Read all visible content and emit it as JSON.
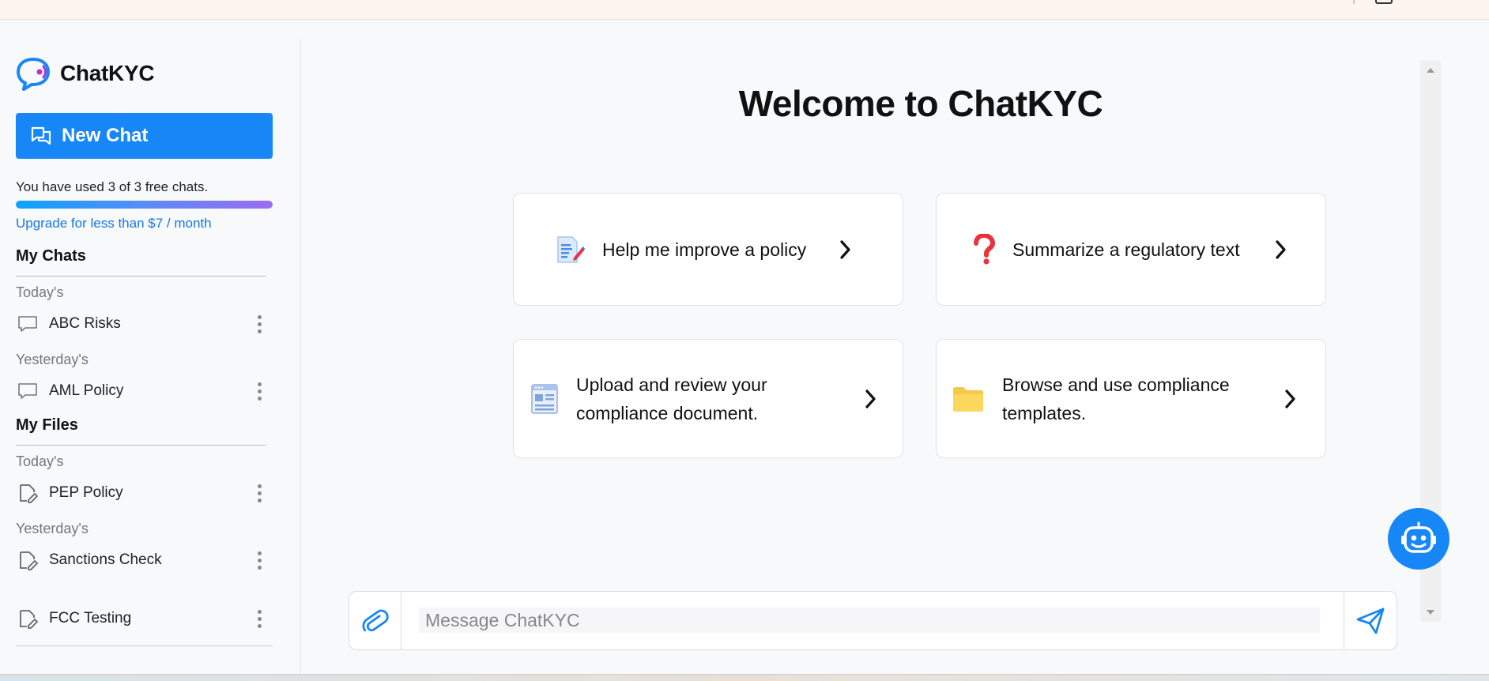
{
  "app": {
    "name": "ChatKYC"
  },
  "sidebar": {
    "new_chat_label": "New Chat",
    "usage_text": "You have used 3 of 3 free chats.",
    "usage_fraction": 1.0,
    "upgrade_label": "Upgrade for less than $7 / month",
    "chats_title": "My Chats",
    "chats": {
      "today_label": "Today's",
      "today": [
        {
          "label": "ABC Risks"
        }
      ],
      "yesterday_label": "Yesterday's",
      "yesterday": [
        {
          "label": "AML Policy"
        }
      ]
    },
    "files_title": "My Files",
    "files": {
      "today_label": "Today's",
      "today": [
        {
          "label": "PEP Policy"
        }
      ],
      "yesterday_label": "Yesterday's",
      "yesterday": [
        {
          "label": "Sanctions Check"
        },
        {
          "label": "FCC Testing"
        }
      ]
    }
  },
  "main": {
    "title": "Welcome to ChatKYC",
    "cards": [
      {
        "line1": "Help me improve a policy",
        "line2": "",
        "icon": "document-edit-icon"
      },
      {
        "line1": "Summarize a regulatory text",
        "line2": "",
        "icon": "question-mark-icon"
      },
      {
        "line1": "Upload and review your",
        "line2": "compliance document.",
        "icon": "document-form-icon"
      },
      {
        "line1": "Browse and use compliance",
        "line2": "templates.",
        "icon": "folder-icon"
      }
    ]
  },
  "composer": {
    "placeholder": "Message ChatKYC"
  },
  "colors": {
    "accent": "#1787f7",
    "link": "#1677e5"
  }
}
